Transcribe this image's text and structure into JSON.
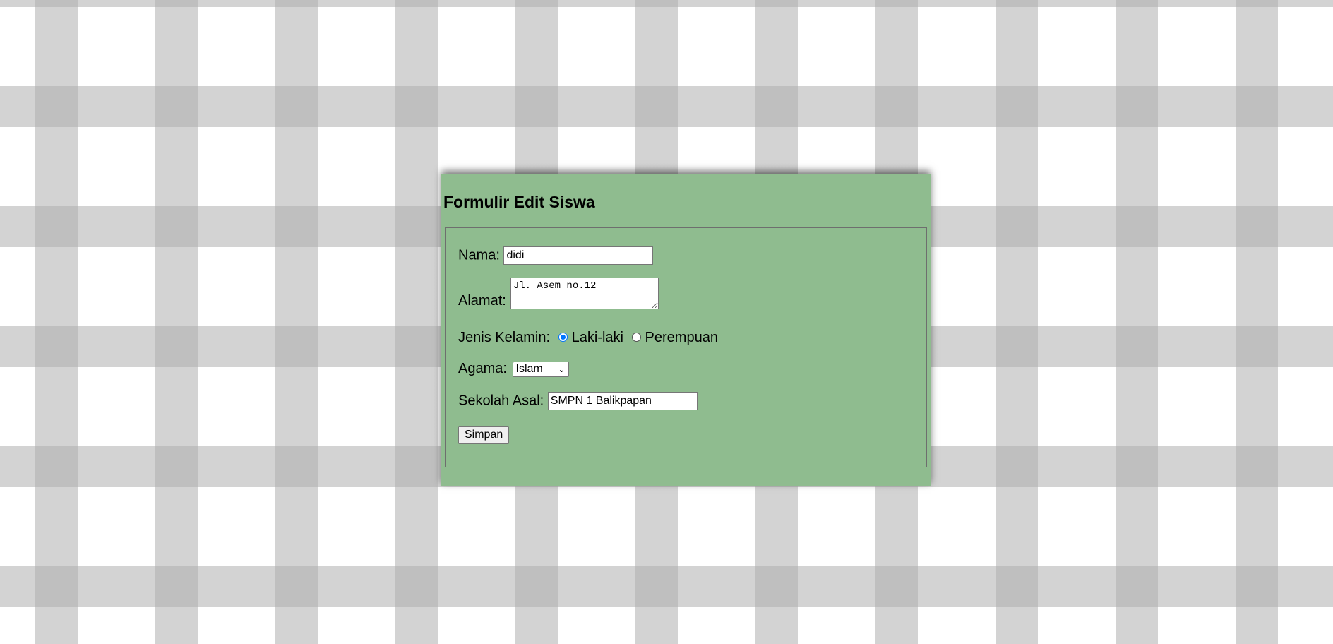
{
  "form": {
    "title": "Formulir Edit Siswa",
    "nama": {
      "label": "Nama:",
      "value": "didi"
    },
    "alamat": {
      "label": "Alamat:",
      "value": "Jl. Asem no.12"
    },
    "jenis_kelamin": {
      "label": "Jenis Kelamin:",
      "options": [
        {
          "label": "Laki-laki",
          "checked": true
        },
        {
          "label": "Perempuan",
          "checked": false
        }
      ]
    },
    "agama": {
      "label": "Agama:",
      "selected": "Islam"
    },
    "sekolah_asal": {
      "label": "Sekolah Asal:",
      "value": "SMPN 1 Balikpapan"
    },
    "submit_label": "Simpan"
  },
  "colors": {
    "panel_background": "#8fbc8f",
    "radio_accent": "#0075ff"
  }
}
